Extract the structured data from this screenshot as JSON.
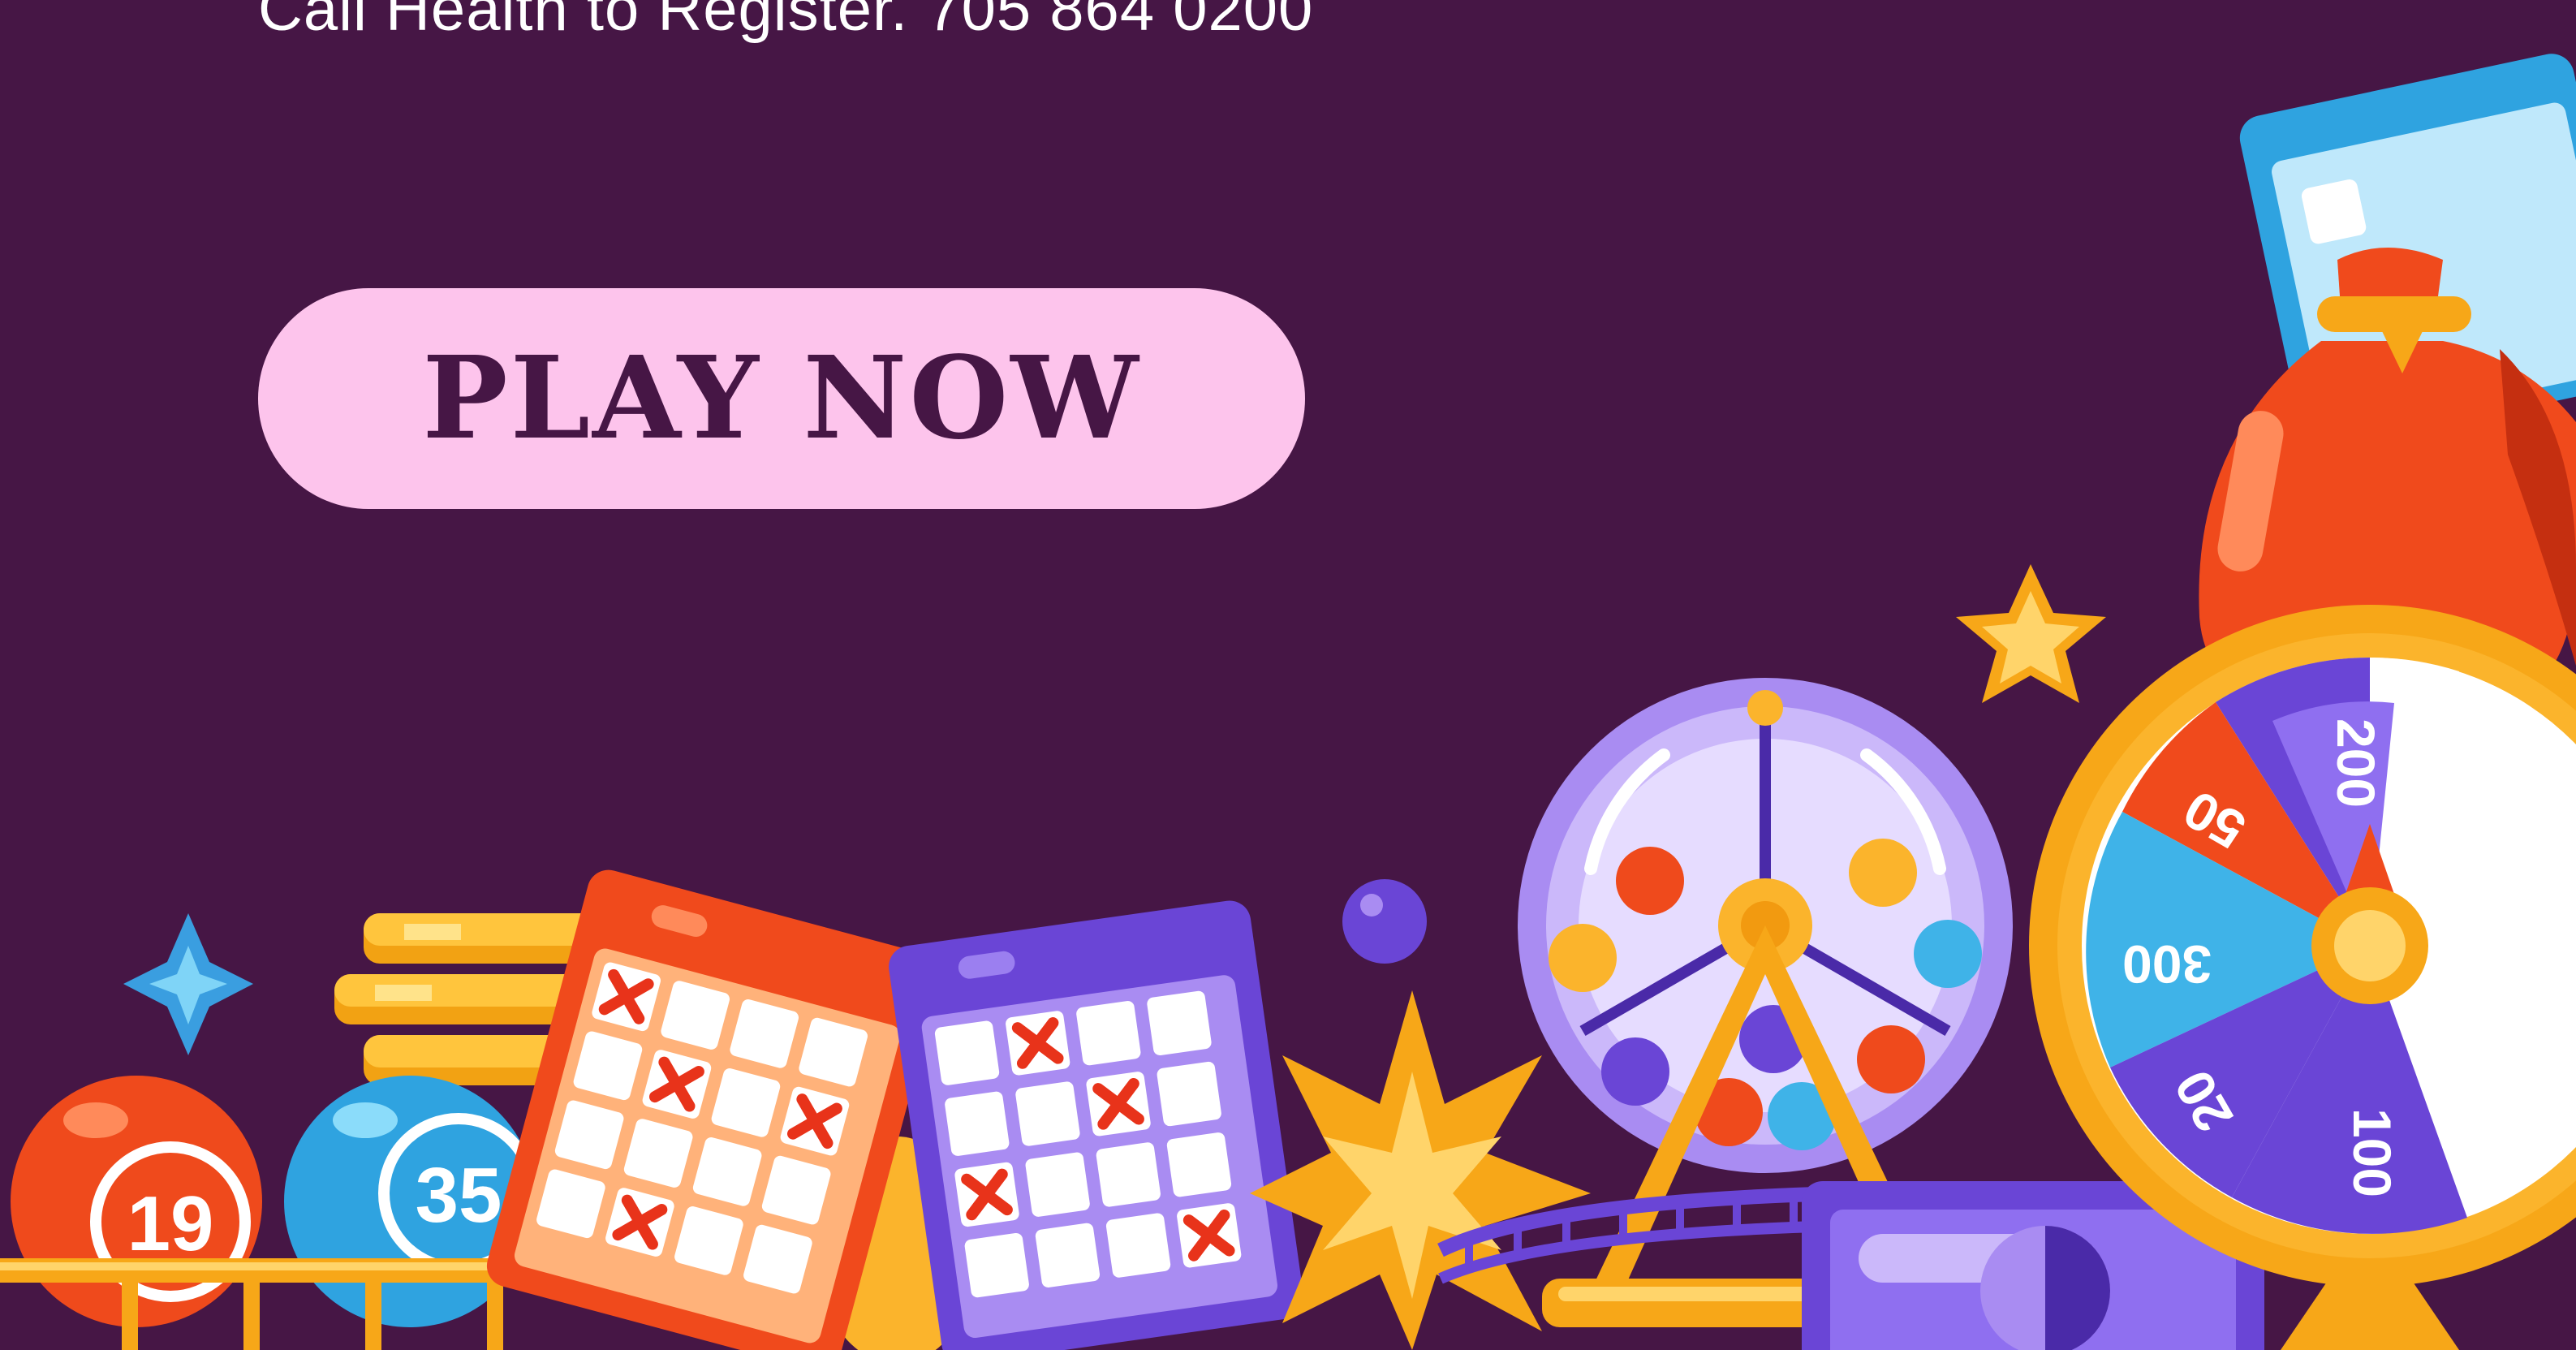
{
  "header": {
    "register_text": "Call Health to Register.  705 864 0200"
  },
  "cta": {
    "label": "PLAY NOW"
  },
  "balls": {
    "red_ball_number": "19",
    "blue_ball_number": "35"
  },
  "prize_wheel": {
    "segments": [
      "200",
      "50",
      "300",
      "20",
      "100"
    ]
  },
  "colors": {
    "background": "#461645",
    "button": "#fdc4ec",
    "button_text": "#461645",
    "orange": "#f04a1c",
    "gold": "#fbb42c",
    "purple": "#6a45d6",
    "blue": "#3fb3e8"
  }
}
